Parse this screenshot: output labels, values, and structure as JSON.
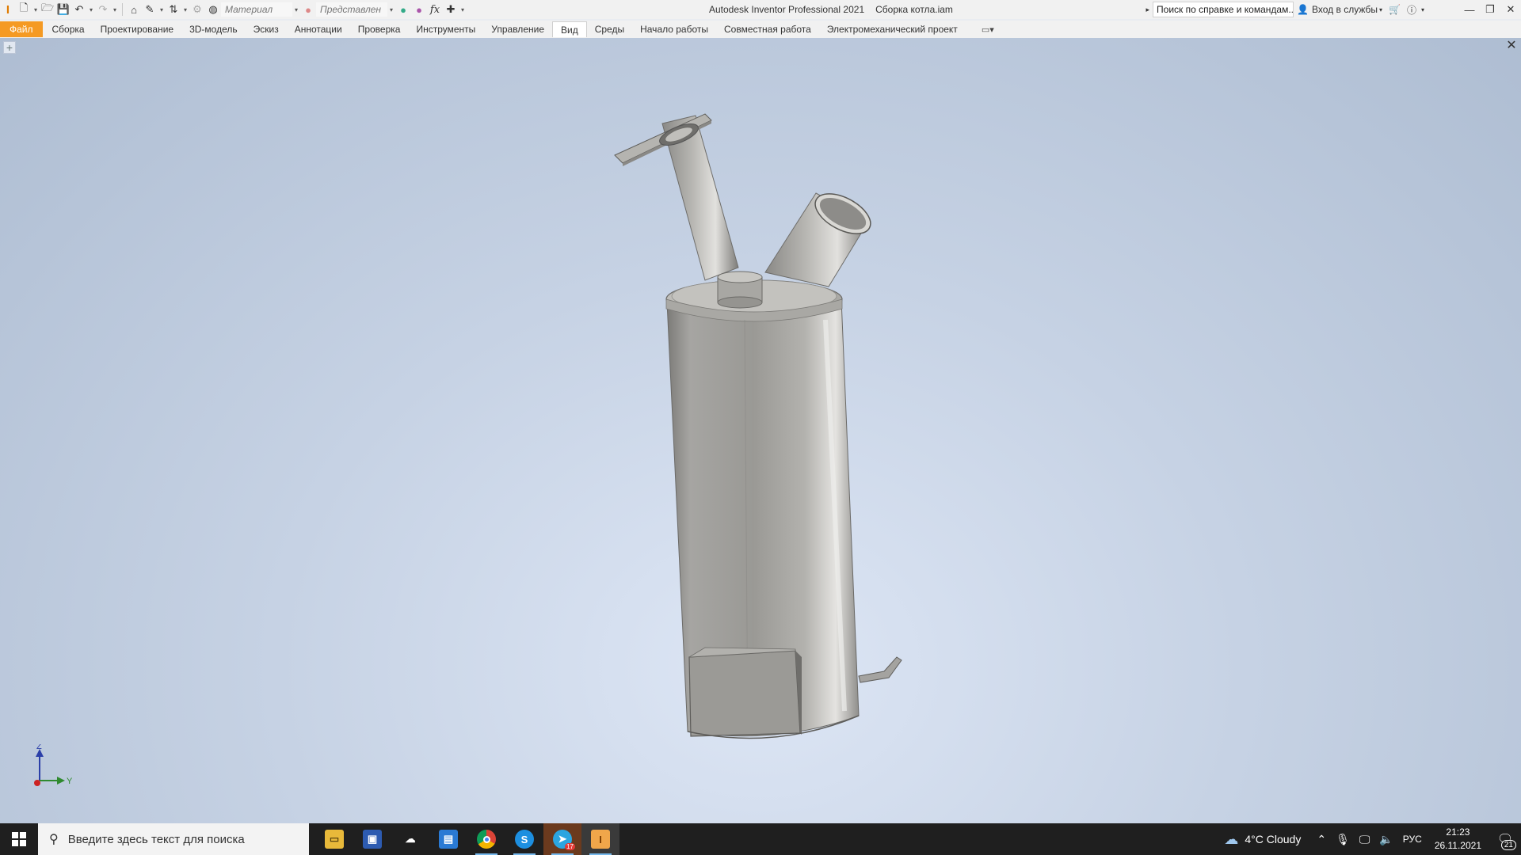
{
  "app": {
    "title": "Autodesk Inventor Professional 2021",
    "document": "Сборка котла.iam"
  },
  "quick_access": {
    "material_combo": "Материал",
    "appearance_combo": "Представлен"
  },
  "help": {
    "search_placeholder": "Поиск по справке и командам...",
    "signin_label": "Вход в службы"
  },
  "ribbon": {
    "tabs": [
      {
        "label": "Файл"
      },
      {
        "label": "Сборка"
      },
      {
        "label": "Проектирование"
      },
      {
        "label": "3D-модель"
      },
      {
        "label": "Эскиз"
      },
      {
        "label": "Аннотации"
      },
      {
        "label": "Проверка"
      },
      {
        "label": "Инструменты"
      },
      {
        "label": "Управление"
      },
      {
        "label": "Вид"
      },
      {
        "label": "Среды"
      },
      {
        "label": "Начало работы"
      },
      {
        "label": "Совместная работа"
      },
      {
        "label": "Электромеханический проект"
      }
    ],
    "active_tab": "Вид"
  },
  "viewport": {
    "triad": {
      "z": "Z",
      "y": "Y"
    }
  },
  "taskbar": {
    "search_placeholder": "Введите здесь текст для поиска",
    "weather": "4°C  Cloudy",
    "language": "РУС",
    "time": "21:23",
    "date": "26.11.2021",
    "notification_count": "21",
    "telegram_badge": "17"
  },
  "colors": {
    "file_tab": "#f59a23",
    "taskbar": "#1f1f1f",
    "viewport_center": "#dde6f5",
    "viewport_edge": "#aebdd2"
  }
}
